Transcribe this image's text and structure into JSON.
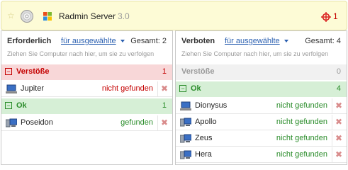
{
  "app": {
    "name": "Radmin Server",
    "version": "3.0",
    "alert_count": "1",
    "icons": [
      "star-icon",
      "cd-icon",
      "windows-logo-icon",
      "crosshair-alert-icon"
    ],
    "colors": {
      "header_bg": "#fdfbd6",
      "danger": "#c40000",
      "ok": "#2a8c2a",
      "link": "#2a5fb0"
    }
  },
  "left": {
    "title": "Erforderlich",
    "filter": "für ausgewählte",
    "total": "Gesamt: 2",
    "hint": "Ziehen Sie Computer nach hier, um sie zu verfolgen",
    "groups": [
      {
        "label": "Verstöße",
        "count": "1",
        "items": [
          {
            "name": "Jupiter",
            "status": "nicht gefunden"
          }
        ]
      },
      {
        "label": "Ok",
        "count": "1",
        "items": [
          {
            "name": "Poseidon",
            "status": "gefunden"
          }
        ]
      }
    ]
  },
  "right": {
    "title": "Verboten",
    "filter": "für ausgewählte",
    "total": "Gesamt: 4",
    "hint": "Ziehen Sie Computer nach hier, um sie zu verfolgen",
    "groups": [
      {
        "label": "Verstöße",
        "count": "0",
        "items": []
      },
      {
        "label": "Ok",
        "count": "4",
        "items": [
          {
            "name": "Dionysus",
            "status": "nicht gefunden"
          },
          {
            "name": "Apollo",
            "status": "nicht gefunden"
          },
          {
            "name": "Zeus",
            "status": "nicht gefunden"
          },
          {
            "name": "Hera",
            "status": "nicht gefunden"
          }
        ]
      }
    ]
  },
  "delete_glyph": "✖"
}
